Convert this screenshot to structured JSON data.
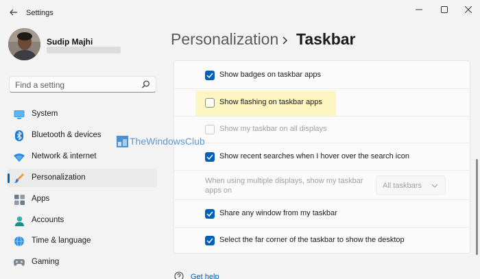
{
  "window": {
    "title": "Settings",
    "controls": [
      "minimize",
      "maximize",
      "close"
    ]
  },
  "user": {
    "name": "Sudip Majhi"
  },
  "search": {
    "placeholder": "Find a setting",
    "icon": "search-icon"
  },
  "sidebar": {
    "items": [
      {
        "label": "System",
        "icon": "monitor-icon",
        "active": false
      },
      {
        "label": "Bluetooth & devices",
        "icon": "bluetooth-icon",
        "active": false
      },
      {
        "label": "Network & internet",
        "icon": "wifi-icon",
        "active": false
      },
      {
        "label": "Personalization",
        "icon": "brush-icon",
        "active": true
      },
      {
        "label": "Apps",
        "icon": "apps-icon",
        "active": false
      },
      {
        "label": "Accounts",
        "icon": "account-icon",
        "active": false
      },
      {
        "label": "Time & language",
        "icon": "globe-clock-icon",
        "active": false
      },
      {
        "label": "Gaming",
        "icon": "gamepad-icon",
        "active": false
      }
    ]
  },
  "breadcrumb": {
    "parent": "Personalization",
    "separator": "chevron-right-icon",
    "current": "Taskbar"
  },
  "settings": {
    "rows": [
      {
        "label": "Show badges on taskbar apps",
        "checked": true,
        "disabled": false,
        "highlighted": false
      },
      {
        "label": "Show flashing on taskbar apps",
        "checked": false,
        "disabled": false,
        "highlighted": true
      },
      {
        "label": "Show my taskbar on all displays",
        "checked": false,
        "disabled": true,
        "highlighted": false
      },
      {
        "label": "Show recent searches when I hover over the search icon",
        "checked": true,
        "disabled": false,
        "highlighted": false
      },
      {
        "label": "When using multiple displays, show my taskbar apps on",
        "type": "dropdown",
        "value": "All taskbars",
        "disabled": true
      },
      {
        "label": "Share any window from my taskbar",
        "checked": true,
        "disabled": false,
        "highlighted": false
      },
      {
        "label": "Select the far corner of the taskbar to show the desktop",
        "checked": true,
        "disabled": false,
        "highlighted": false
      }
    ]
  },
  "watermark": {
    "text": "TheWindowsClub"
  },
  "help": {
    "label": "Get help",
    "icon": "help-icon"
  },
  "colors": {
    "accent": "#005fb8",
    "highlight": "#fdf6c3",
    "background": "#f3f3f3",
    "card": "#fbfbfb"
  }
}
